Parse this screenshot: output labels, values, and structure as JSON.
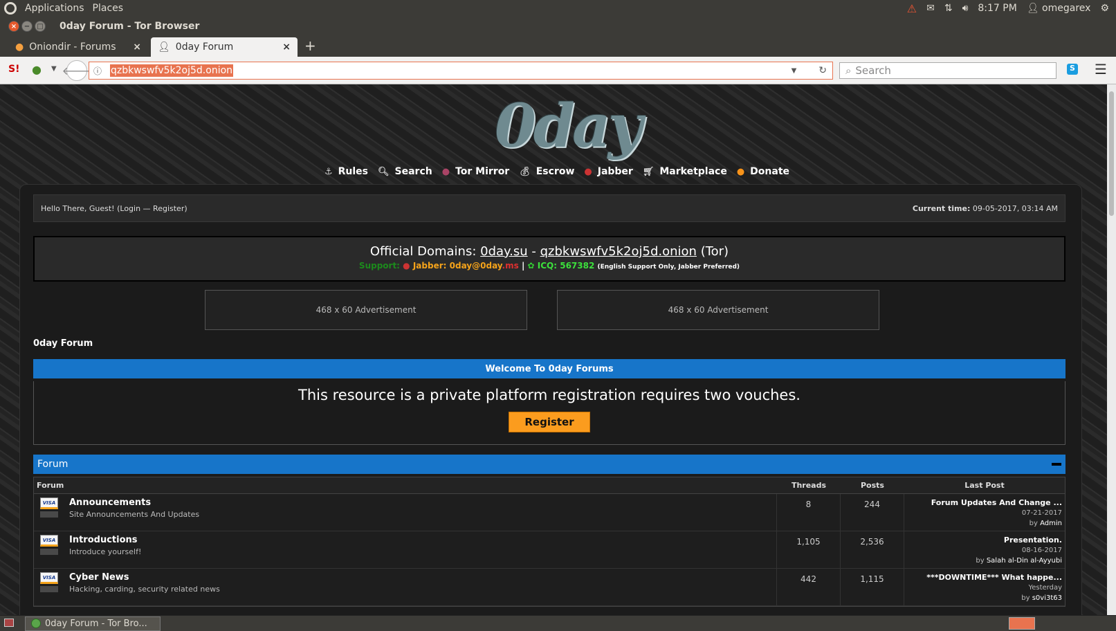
{
  "system": {
    "menu_applications": "Applications",
    "menu_places": "Places",
    "clock": "8:17 PM",
    "user": "omegarex"
  },
  "window": {
    "title": "0day Forum - Tor Browser"
  },
  "tabs": [
    {
      "label": "Oniondir - Forums"
    },
    {
      "label": "0day Forum"
    }
  ],
  "navbar": {
    "url": "qzbkwswfv5k2oj5d.onion",
    "search_placeholder": "Search"
  },
  "site": {
    "logo": "0day",
    "nav": [
      {
        "label": "Rules",
        "icon": "anchor-icon"
      },
      {
        "label": "Search",
        "icon": "magnifier-icon"
      },
      {
        "label": "Tor Mirror",
        "icon": "onion-icon"
      },
      {
        "label": "Escrow",
        "icon": "money-bag-icon"
      },
      {
        "label": "Jabber",
        "icon": "jabber-icon"
      },
      {
        "label": "Marketplace",
        "icon": "cart-icon"
      },
      {
        "label": "Donate",
        "icon": "bitcoin-icon"
      }
    ],
    "greeting": "Hello There, Guest! (Login — Register)",
    "current_time_label": "Current time:",
    "current_time": "09-05-2017, 03:14 AM",
    "domains": {
      "prefix": "Official Domains:",
      "domain1": "0day.su",
      "sep": "-",
      "domain2": "qzbkwswfv5k2oj5d.onion",
      "suffix": "(Tor)",
      "support_label": "Support:",
      "jabber_label": "Jabber:",
      "jabber_user": "0day@0day",
      "jabber_tld": ".ms",
      "pipe": "|",
      "icq_label": "ICQ: 567382",
      "icq_note": "(English Support Only, Jabber Preferred)"
    },
    "ads": [
      "468 x 60 Advertisement",
      "468 x 60 Advertisement"
    ],
    "breadcrumb": "0day Forum",
    "welcome_title": "Welcome To 0day Forums",
    "welcome_msg": "This resource is a private platform registration requires two vouches.",
    "register_label": "Register",
    "forum_section_title": "Forum",
    "columns": {
      "forum": "Forum",
      "threads": "Threads",
      "posts": "Posts",
      "last_post": "Last Post"
    },
    "forums": [
      {
        "name": "Announcements",
        "desc": "Site Announcements And Updates",
        "threads": "8",
        "posts": "244",
        "last_title": "Forum Updates And Change ...",
        "last_date": "07-21-2017",
        "by": "by",
        "last_user": "Admin"
      },
      {
        "name": "Introductions",
        "desc": "Introduce yourself!",
        "threads": "1,105",
        "posts": "2,536",
        "last_title": "Presentation.",
        "last_date": "08-16-2017",
        "by": "by",
        "last_user": "Salah al-Din al-Ayyubi"
      },
      {
        "name": "Cyber News",
        "desc": "Hacking, carding, security related news",
        "threads": "442",
        "posts": "1,115",
        "last_title": "***DOWNTIME*** What happe...",
        "last_date": "Yesterday",
        "by": "by",
        "last_user": "s0vi3t63"
      }
    ],
    "card_text": "VISA"
  },
  "taskbar": {
    "item": "0day Forum - Tor Bro..."
  },
  "colors": {
    "accent_blue": "#1775c9",
    "register_orange": "#fb9c1e",
    "url_highlight": "#e8734f"
  }
}
